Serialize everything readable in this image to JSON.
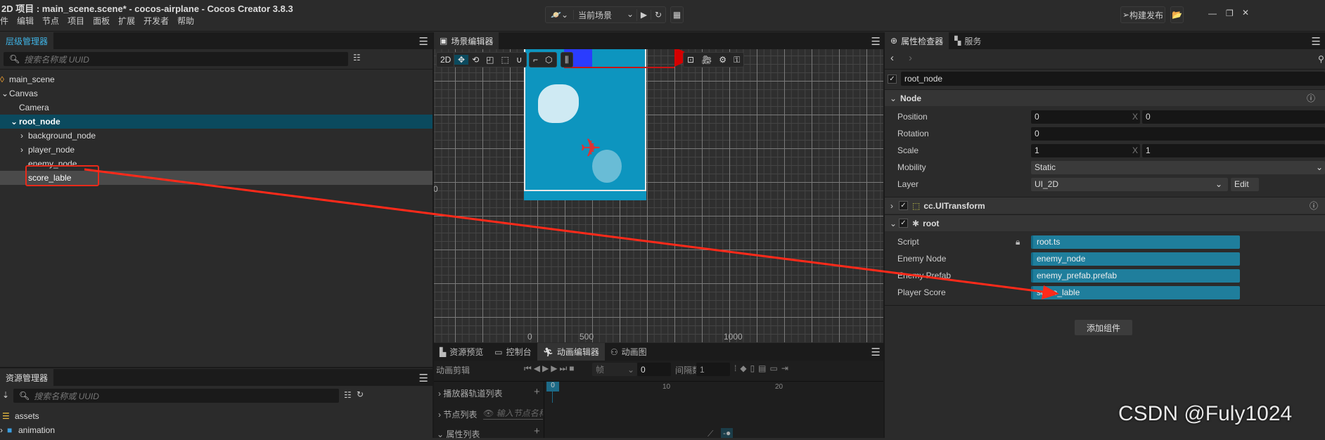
{
  "window": {
    "title": "2D 项目 : main_scene.scene* - cocos-airplane - Cocos Creator 3.8.3"
  },
  "menu": [
    "件",
    "编辑",
    "节点",
    "项目",
    "面板",
    "扩展",
    "开发者",
    "帮助"
  ],
  "toolbar": {
    "scene_select": "当前场景",
    "build_label": "构建发布"
  },
  "hierarchy": {
    "tab": "层级管理器",
    "search_placeholder": "搜索名称或 UUID",
    "nodes": [
      "main_scene",
      "Canvas",
      "Camera",
      "root_node",
      "background_node",
      "player_node",
      "enemy_node",
      "score_lable"
    ]
  },
  "assets": {
    "tab": "资源管理器",
    "search_placeholder": "搜索名称或 UUID",
    "items": [
      "assets",
      "animation"
    ]
  },
  "scene": {
    "tab": "场景编辑器",
    "mode": "2D",
    "axis_labels": {
      "y0": "0",
      "x0": "0",
      "x500": "500",
      "x1000": "1000"
    }
  },
  "bottom": {
    "tabs": [
      "资源预览",
      "控制台",
      "动画编辑器",
      "动画图"
    ],
    "clip_label": "动画剪辑",
    "unit": "帧",
    "frame": "0",
    "interval_label": "间隔数",
    "interval": "1",
    "rows": [
      "播放器轨道列表",
      "节点列表",
      "属性列表"
    ],
    "node_filter_placeholder": "输入节点名称过",
    "ticks": [
      "0",
      "10",
      "20"
    ]
  },
  "inspector": {
    "tabs": [
      "属性检查器",
      "服务"
    ],
    "node_name": "root_node",
    "node_section": "Node",
    "position": {
      "label": "Position",
      "x": "0",
      "y": "0"
    },
    "rotation": {
      "label": "Rotation",
      "value": "0"
    },
    "scale": {
      "label": "Scale",
      "x": "1",
      "y": "1"
    },
    "mobility": {
      "label": "Mobility",
      "value": "Static"
    },
    "layer": {
      "label": "Layer",
      "value": "UI_2D",
      "edit": "Edit"
    },
    "axis_x": "X",
    "uitransform": "cc.UITransform",
    "root_section": "root",
    "props": [
      {
        "label": "Script",
        "value": "root.ts"
      },
      {
        "label": "Enemy Node",
        "value": "enemy_node"
      },
      {
        "label": "Enemy Prefab",
        "value": "enemy_prefab.prefab"
      },
      {
        "label": "Player Score",
        "value": "score_lable"
      }
    ],
    "add_component": "添加组件"
  },
  "watermark": "CSDN @Fuly1024",
  "colors": {
    "accent": "#1f7e9c",
    "selected_row": "#0b4a5e",
    "annotation": "#ff2a1a"
  }
}
